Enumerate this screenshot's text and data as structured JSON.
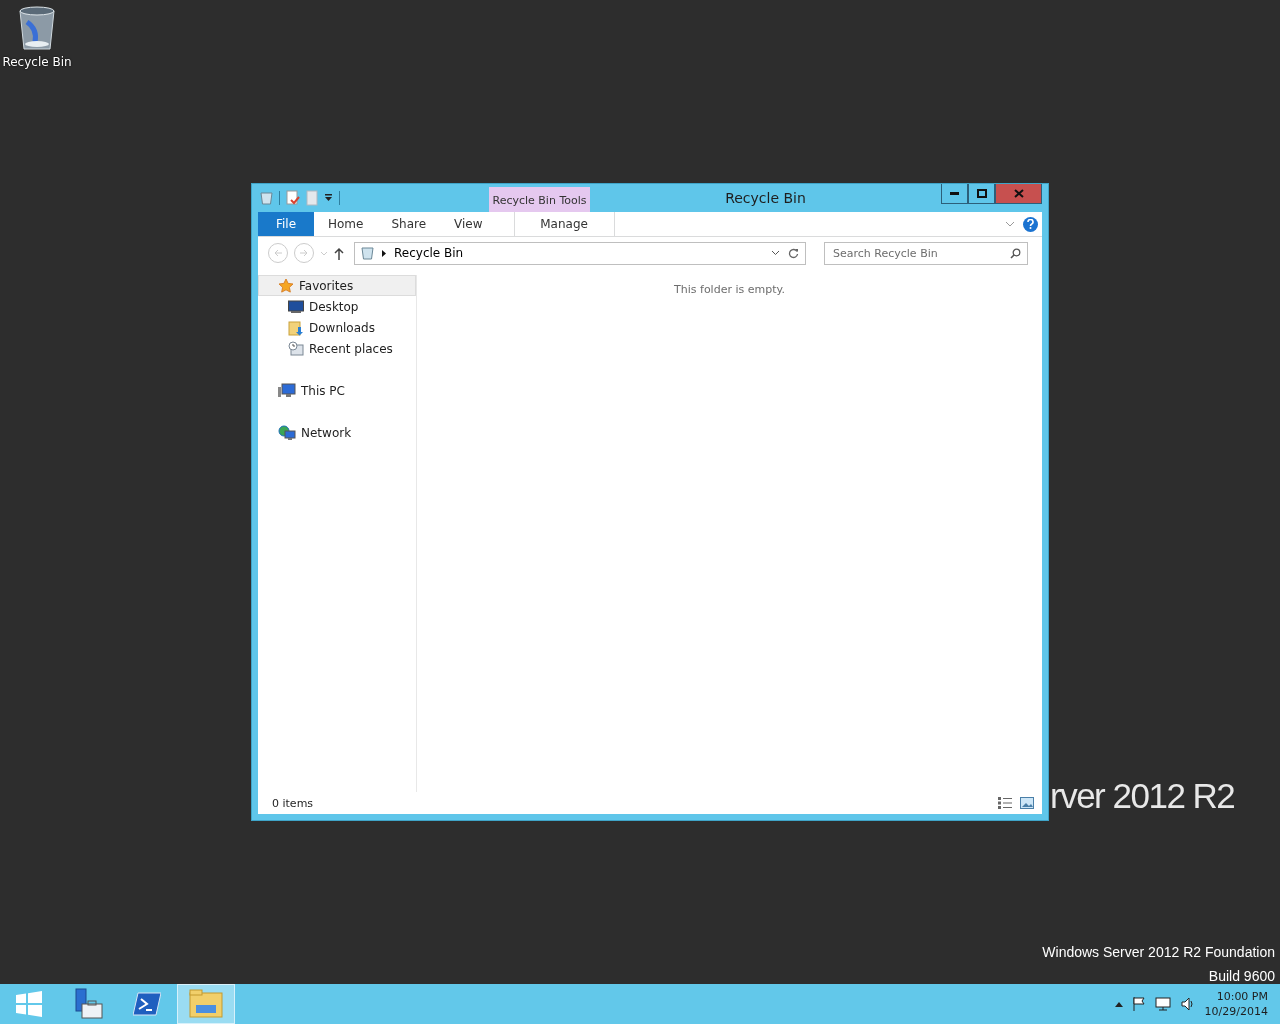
{
  "desktop": {
    "icons": [
      {
        "label": "Recycle Bin",
        "kind": "recycle-bin"
      }
    ],
    "wallpaper_text": "rver 2012 R2",
    "edition_lines": [
      "Windows Server 2012 R2 Foundation",
      "Build 9600"
    ]
  },
  "window": {
    "title": "Recycle Bin",
    "contextual_group": "Recycle Bin Tools",
    "ribbon_tabs": [
      {
        "label": "File",
        "kind": "file"
      },
      {
        "label": "Home",
        "kind": "normal"
      },
      {
        "label": "Share",
        "kind": "normal"
      },
      {
        "label": "View",
        "kind": "normal"
      },
      {
        "label": "Manage",
        "kind": "contextual"
      }
    ],
    "address": {
      "path": "Recycle Bin"
    },
    "search": {
      "placeholder": "Search Recycle Bin"
    },
    "nav_pane": [
      {
        "label": "Favorites",
        "kind": "star",
        "selected": true,
        "children": [
          {
            "label": "Desktop",
            "kind": "desktop",
            "selected": false
          },
          {
            "label": "Downloads",
            "kind": "downloads",
            "selected": false
          },
          {
            "label": "Recent places",
            "kind": "recent",
            "selected": false
          }
        ]
      },
      {
        "label": "This PC",
        "kind": "pc",
        "selected": false
      },
      {
        "label": "Network",
        "kind": "network",
        "selected": false
      }
    ],
    "empty_message": "This folder is empty.",
    "status": "0 items"
  },
  "taskbar": {
    "buttons": [
      {
        "kind": "start",
        "selected": false
      },
      {
        "kind": "server-manager",
        "selected": false
      },
      {
        "kind": "powershell",
        "selected": false
      },
      {
        "kind": "explorer",
        "selected": true
      }
    ],
    "clock": {
      "time": "10:00 PM",
      "date": "10/29/2014"
    }
  }
}
